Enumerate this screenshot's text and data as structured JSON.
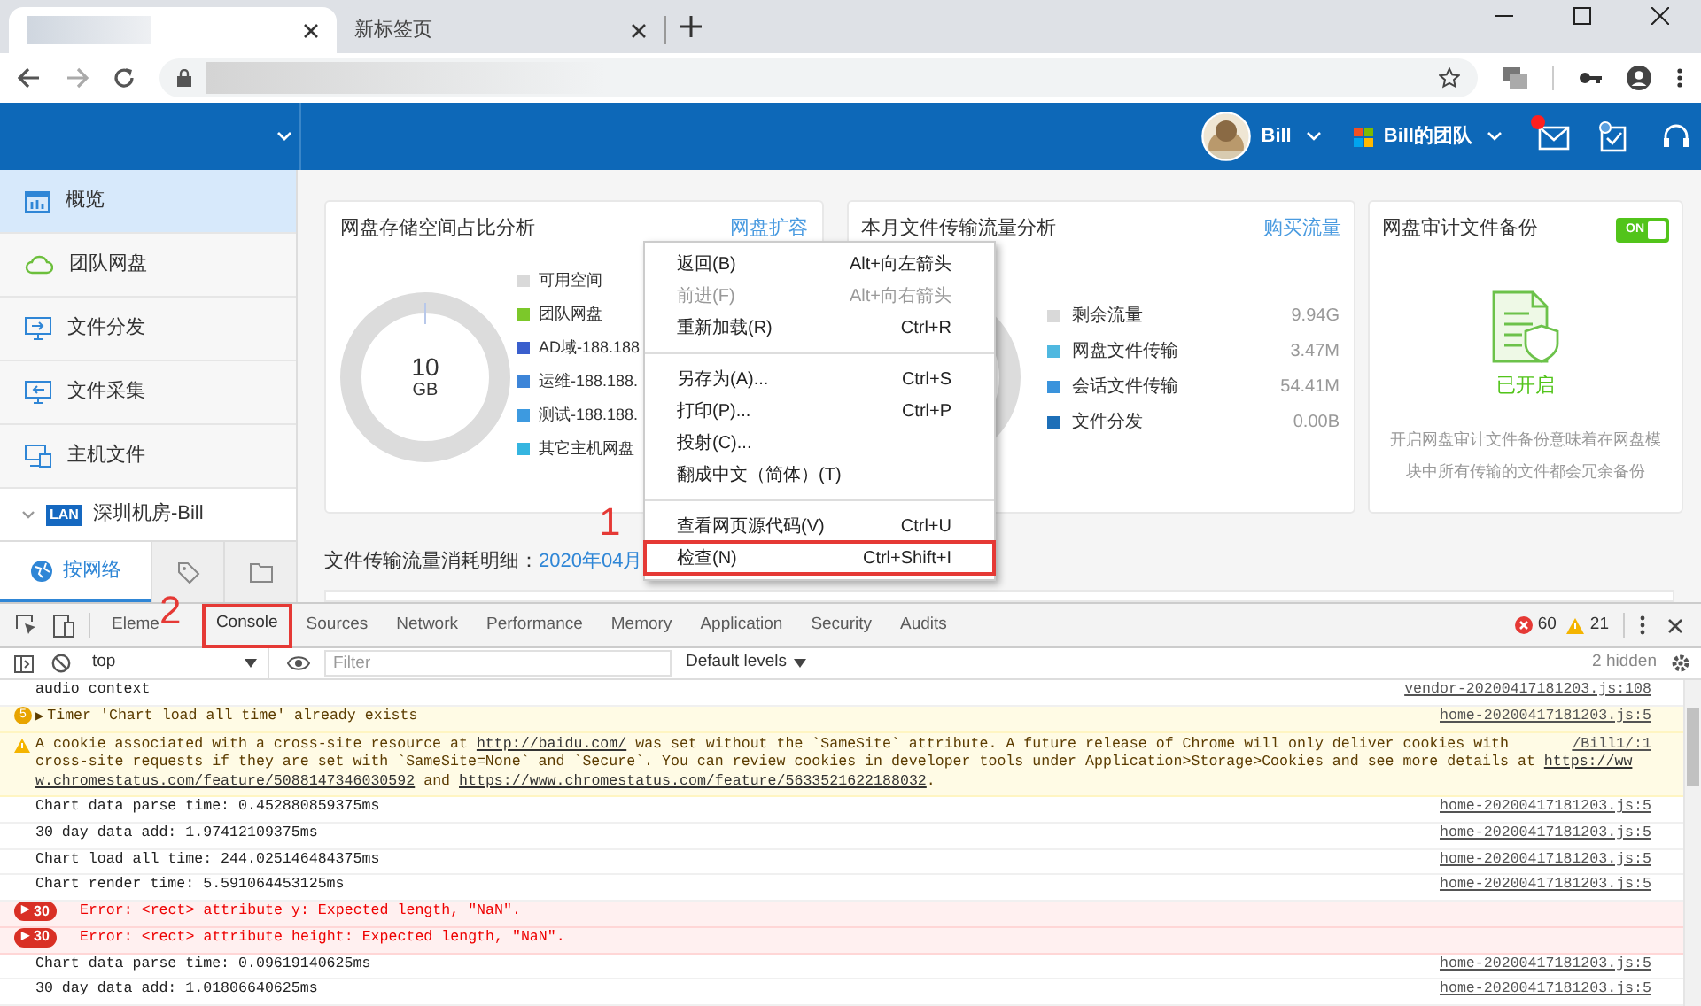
{
  "browser": {
    "tabs": [
      {
        "selected": true
      },
      {
        "label": "新标签页",
        "selected": false
      }
    ]
  },
  "app_header": {
    "user": "Bill",
    "team": "Bill的团队",
    "mail_unread": true
  },
  "sidebar": {
    "items": [
      {
        "label": "概览",
        "kind": "chart",
        "selected": true
      },
      {
        "label": "团队网盘",
        "kind": "cloud",
        "selected": false
      },
      {
        "label": "文件分发",
        "kind": "send",
        "selected": false
      },
      {
        "label": "文件采集",
        "kind": "collect",
        "selected": false
      },
      {
        "label": "主机文件",
        "kind": "host",
        "selected": false
      }
    ],
    "tree": {
      "badge": "LAN",
      "label": "深圳机房-Bill",
      "expanded": true
    },
    "bottom_tabs": [
      {
        "kind": "network",
        "label": "按网络",
        "selected": true
      },
      {
        "kind": "tag",
        "selected": false
      },
      {
        "kind": "folder",
        "selected": false
      }
    ]
  },
  "storage_card": {
    "title": "网盘存储空间占比分析",
    "link": "网盘扩容",
    "total_value": "10",
    "total_unit": "GB",
    "legend": [
      {
        "label": "可用空间",
        "color": "#d9d9d9"
      },
      {
        "label": "团队网盘",
        "color": "#7cc82a"
      },
      {
        "label": "AD域-188.188",
        "color": "#3a5fcd"
      },
      {
        "label": "运维-188.188.",
        "color": "#3d85d8"
      },
      {
        "label": "测试-188.188.",
        "color": "#3d9ae0"
      },
      {
        "label": "其它主机网盘",
        "color": "#35b5e0"
      }
    ]
  },
  "traffic_card": {
    "title": "本月文件传输流量分析",
    "link": "购买流量",
    "legend": [
      {
        "label": "剩余流量",
        "value": "9.94G",
        "color": "#d9d9d9"
      },
      {
        "label": "网盘文件传输",
        "value": "3.47M",
        "color": "#4fb8e0"
      },
      {
        "label": "会话文件传输",
        "value": "54.41M",
        "color": "#3a93dc"
      },
      {
        "label": "文件分发",
        "value": "0.00B",
        "color": "#1d6fb8"
      }
    ]
  },
  "backup_card": {
    "title": "网盘审计文件备份",
    "toggle": {
      "on": true,
      "label": "ON"
    },
    "status": "已开启",
    "description": "开启网盘审计文件备份意味着在网盘模块中所有传输的文件都会冗余备份"
  },
  "detail": {
    "label": "文件传输流量消耗明细：",
    "value": "2020年04月"
  },
  "context_menu": {
    "groups": [
      [
        {
          "label": "返回(B)",
          "shortcut": "Alt+向左箭头",
          "disabled": false
        },
        {
          "label": "前进(F)",
          "shortcut": "Alt+向右箭头",
          "disabled": true
        },
        {
          "label": "重新加载(R)",
          "shortcut": "Ctrl+R",
          "disabled": false
        }
      ],
      [
        {
          "label": "另存为(A)...",
          "shortcut": "Ctrl+S",
          "disabled": false
        },
        {
          "label": "打印(P)...",
          "shortcut": "Ctrl+P",
          "disabled": false
        },
        {
          "label": "投射(C)...",
          "disabled": false
        },
        {
          "label": "翻成中文（简体）(T)",
          "disabled": false
        }
      ],
      [
        {
          "label": "查看网页源代码(V)",
          "shortcut": "Ctrl+U",
          "disabled": false
        },
        {
          "label": "检查(N)",
          "shortcut": "Ctrl+Shift+I",
          "disabled": false,
          "annotation": "1"
        }
      ]
    ]
  },
  "devtools": {
    "tabs": [
      {
        "label": "Eleme",
        "selected": false
      },
      {
        "label": "Console",
        "selected": true,
        "annotation": "2"
      },
      {
        "label": "Sources",
        "selected": false
      },
      {
        "label": "Network",
        "selected": false
      },
      {
        "label": "Performance",
        "selected": false
      },
      {
        "label": "Memory",
        "selected": false
      },
      {
        "label": "Application",
        "selected": false
      },
      {
        "label": "Security",
        "selected": false
      },
      {
        "label": "Audits",
        "selected": false
      }
    ],
    "errors": "60",
    "warnings": "21",
    "filter": {
      "context": "top",
      "placeholder": "Filter",
      "levels": "Default levels",
      "hidden": "2 hidden"
    },
    "messages": [
      {
        "kind": "log",
        "text": "audio context",
        "source": "vendor-20200417181203.js:108"
      },
      {
        "kind": "warning",
        "count": "5",
        "toggle": "▶",
        "text": "Timer 'Chart load all time' already exists",
        "source": "home-20200417181203.js:5"
      },
      {
        "kind": "warning",
        "lines": [
          [
            {
              "text": "A cookie associated with a cross-site resource at "
            },
            {
              "text": "http://baidu.com/",
              "link": true
            },
            {
              "text": " was set without the `SameSite` attribute. A future release of Chrome will only deliver cookies with"
            }
          ],
          [
            {
              "text": "cross-site requests if they are set with `SameSite=None` and `Secure`. You can review cookies in developer tools under Application>Storage>Cookies and see more details at "
            },
            {
              "text": "https://ww",
              "link": true
            }
          ],
          [
            {
              "text": "w.chromestatus.com/feature/5088147346030592",
              "link": true
            },
            {
              "text": " and "
            },
            {
              "text": "https://www.chromestatus.com/feature/5633521622188032",
              "link": true
            },
            {
              "text": "."
            }
          ]
        ],
        "source": "/Bill1/:1"
      },
      {
        "kind": "log",
        "text": "Chart data parse time: 0.452880859375ms",
        "source": "home-20200417181203.js:5"
      },
      {
        "kind": "log",
        "text": "30 day data add: 1.97412109375ms",
        "source": "home-20200417181203.js:5"
      },
      {
        "kind": "log",
        "text": "Chart load all time: 244.025146484375ms",
        "source": "home-20200417181203.js:5"
      },
      {
        "kind": "log",
        "text": "Chart render time: 5.591064453125ms",
        "source": "home-20200417181203.js:5"
      },
      {
        "kind": "error",
        "count": "30",
        "toggle": "▶",
        "text": "Error: <rect> attribute y: Expected length, \"NaN\"."
      },
      {
        "kind": "error",
        "count": "30",
        "toggle": "▶",
        "text": "Error: <rect> attribute height: Expected length, \"NaN\"."
      },
      {
        "kind": "log",
        "text": "Chart data parse time: 0.09619140625ms",
        "source": "home-20200417181203.js:5"
      },
      {
        "kind": "log",
        "text": "30 day data add: 1.01806640625ms",
        "source": "home-20200417181203.js:5"
      }
    ]
  }
}
